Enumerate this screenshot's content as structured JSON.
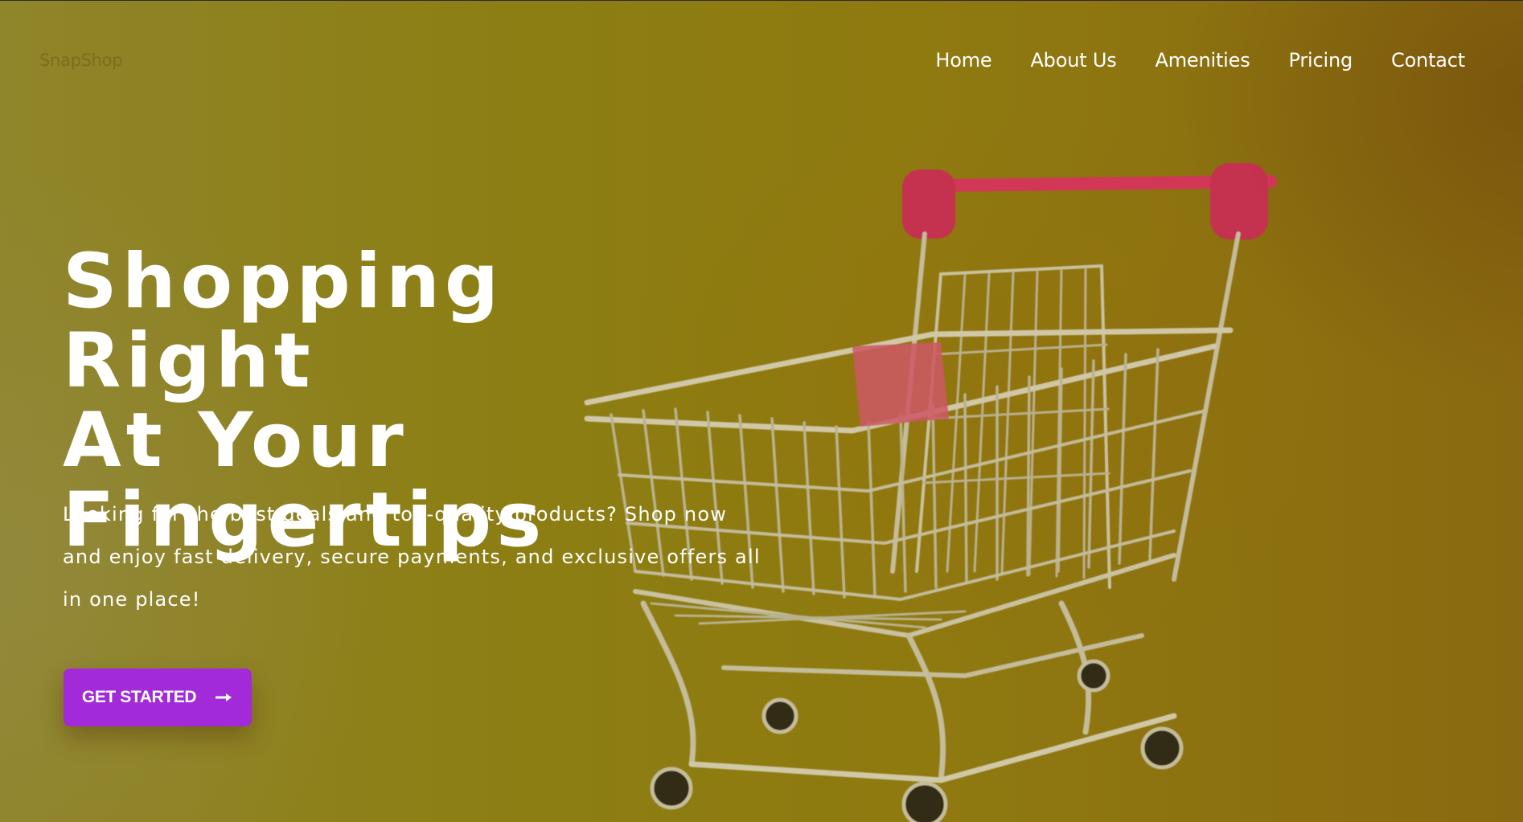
{
  "brand": {
    "name": "SnapShop"
  },
  "nav": {
    "items": [
      {
        "label": "Home"
      },
      {
        "label": "About Us"
      },
      {
        "label": "Amenities"
      },
      {
        "label": "Pricing"
      },
      {
        "label": "Contact"
      }
    ]
  },
  "hero": {
    "headline_line1": "Shopping Right",
    "headline_line2": "At Your",
    "headline_line3": "Fingertips",
    "description": "Looking for the best deals and top-quality products? Shop now and enjoy fast delivery, secure payments, and exclusive offers all in one place!",
    "cta_label": "GET STARTED",
    "cta_icon": "arrow-right-icon",
    "image_subject": "shopping-cart-image"
  },
  "colors": {
    "background": "#8c7e12",
    "cta": "#a22ad8",
    "text": "#ffffff",
    "cart_handle": "#d8325f",
    "cart_metal": "#c9c2a6"
  }
}
